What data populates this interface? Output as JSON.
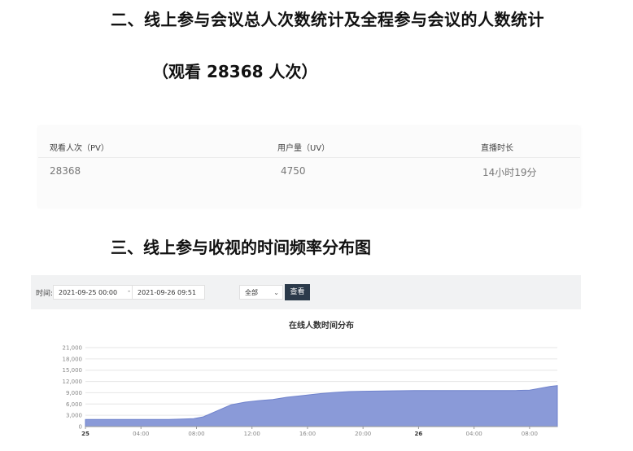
{
  "heading2": "二、线上参与会议总人次数统计及全程参与会议的人数统计",
  "subheading": "（观看 28368 人次）",
  "stats": {
    "headers": [
      "观看人次（PV）",
      "用户量（UV）",
      "直播时长"
    ],
    "values": [
      "28368",
      "4750",
      "14小时19分"
    ]
  },
  "heading3": "三、线上参与收视的时间频率分布图",
  "filter": {
    "label": "时间:",
    "start": "2021-09-25 00:00",
    "separator": "-",
    "end": "2021-09-26 09:51",
    "select_value": "全部",
    "query_button": "查看"
  },
  "chart_data": {
    "type": "area",
    "title": "在线人数时间分布",
    "xlabel": "",
    "ylabel": "",
    "ylim": [
      0,
      21000
    ],
    "yticks": [
      "0",
      "3,000",
      "6,000",
      "9,000",
      "12,000",
      "15,000",
      "18,000",
      "21,000"
    ],
    "ytick_values": [
      0,
      3000,
      6000,
      9000,
      12000,
      15000,
      18000,
      21000
    ],
    "xlim": [
      0,
      34
    ],
    "xtick_labels": [
      "25",
      "04:00",
      "08:00",
      "12:00",
      "16:00",
      "20:00",
      "26",
      "04:00",
      "08:00"
    ],
    "xtick_hours": [
      0,
      4,
      8,
      12,
      16,
      20,
      24,
      28,
      32
    ],
    "xtick_bold": [
      true,
      false,
      false,
      false,
      false,
      false,
      true,
      false,
      false
    ],
    "grid": true,
    "legend": "none",
    "fill_color": "#8a9ad8",
    "series": [
      {
        "x": [
          0,
          2,
          4,
          6,
          7,
          7.8,
          8.5,
          9.5,
          10.5,
          11.5,
          12.5,
          13.5,
          14.5,
          16,
          17,
          18,
          19,
          20,
          22,
          24,
          26,
          28,
          30,
          31,
          32,
          32.5,
          33.5,
          34
        ],
        "values": [
          1900,
          1900,
          1900,
          1900,
          2000,
          2100,
          2600,
          4200,
          5800,
          6500,
          6900,
          7200,
          7800,
          8400,
          8800,
          9100,
          9300,
          9400,
          9500,
          9600,
          9600,
          9600,
          9600,
          9600,
          9700,
          10000,
          10700,
          10900
        ]
      }
    ]
  }
}
